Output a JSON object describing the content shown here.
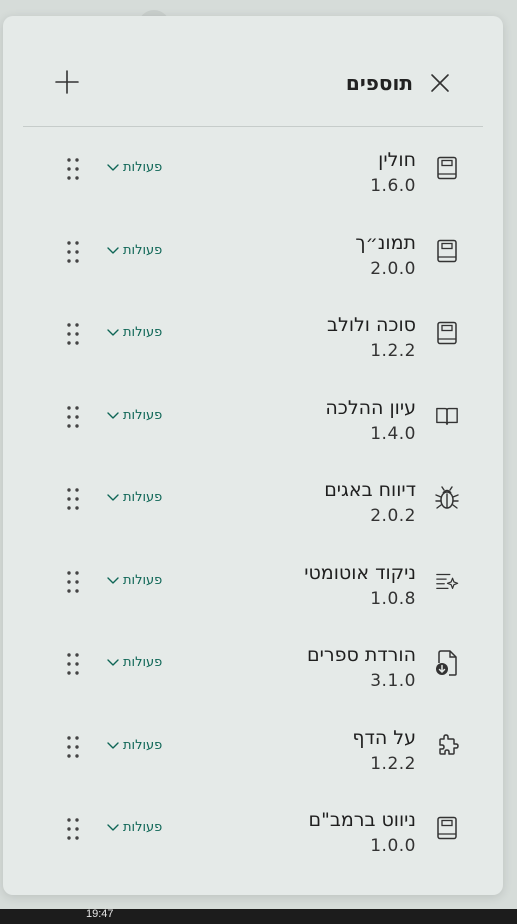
{
  "header": {
    "title": "תוספים",
    "close_icon": "close-icon",
    "add_icon": "plus-icon"
  },
  "items": [
    {
      "name": "חולין",
      "version": "1.6.0",
      "icon": "book-icon",
      "actions_label": "פעולות"
    },
    {
      "name": "תמונ״ך",
      "version": "2.0.0",
      "icon": "book-icon",
      "actions_label": "פעולות"
    },
    {
      "name": "סוכה ולולב",
      "version": "1.2.2",
      "icon": "book-icon",
      "actions_label": "פעולות"
    },
    {
      "name": "עיון ההלכה",
      "version": "1.4.0",
      "icon": "open-book-icon",
      "actions_label": "פעולות"
    },
    {
      "name": "דיווח באגים",
      "version": "2.0.2",
      "icon": "bug-icon",
      "actions_label": "פעולות"
    },
    {
      "name": "ניקוד אוטומטי",
      "version": "1.0.8",
      "icon": "text-sparkle-icon",
      "actions_label": "פעולות"
    },
    {
      "name": "הורדת ספרים",
      "version": "3.1.0",
      "icon": "document-download-icon",
      "actions_label": "פעולות"
    },
    {
      "name": "על הדף",
      "version": "1.2.2",
      "icon": "puzzle-icon",
      "actions_label": "פעולות"
    },
    {
      "name": "ניווט ברמב\"ם",
      "version": "1.0.0",
      "icon": "book-icon",
      "actions_label": "פעולות"
    }
  ],
  "taskbar": {
    "clock": "19:47"
  },
  "colors": {
    "accent": "#0e6656",
    "panel_bg": "#e5eae8",
    "page_bg": "#d6dcd9"
  }
}
